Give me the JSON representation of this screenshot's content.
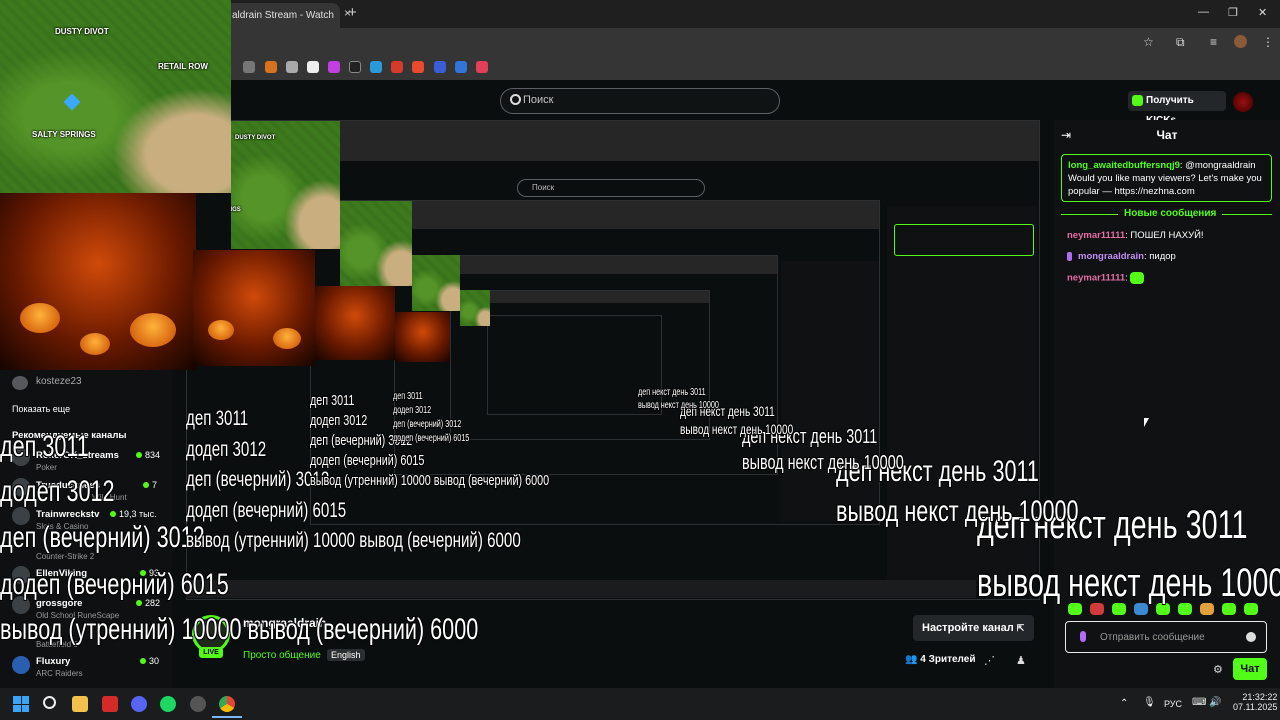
{
  "browser": {
    "tab_title": "aldrain Stream - Watch",
    "tab_close": "×",
    "new_tab": "+",
    "window_controls": [
      "—",
      "❐",
      "✕"
    ]
  },
  "header": {
    "search_placeholder": "Поиск",
    "get_kicks": "Получить KICKs"
  },
  "chat": {
    "title": "Чат",
    "pinned": {
      "user": "long_awaitedbuffersnqj9",
      "text": ": @mongraaldrain Would you like many viewers? Let's make you popular — https://nezhna.com"
    },
    "new_messages": "Новые сообщения",
    "messages": [
      {
        "user": "neymar11111",
        "text": ": ПОШЕЛ НАХУЙ!"
      },
      {
        "user": "mongraaldrain",
        "text": ": пидор"
      },
      {
        "user": "neymar11111",
        "text": ":"
      }
    ],
    "input_placeholder": "Отправить сообщение",
    "send_button": "Чат"
  },
  "stream": {
    "streamer": "mongraaldrain",
    "live": "LIVE",
    "category": "Просто общение",
    "language": "English",
    "setup_button": "Настройте канал",
    "viewers": "4 Зрителей"
  },
  "sidebar": {
    "user": "kosteze23",
    "show_more": "Показать еще",
    "recommended_header": "Рекомендуемые каналы",
    "channels": [
      {
        "name": "RokerOK_streams",
        "category": "Poker",
        "count": "834"
      },
      {
        "name": "Trueduckness",
        "category": "Wild Hunt",
        "count": "7"
      },
      {
        "name": "Trainwreckstv",
        "category": "Slots & Casino",
        "count": "19,3 тыс."
      },
      {
        "name": "",
        "category": "Counter-Strike 2",
        "count": ""
      },
      {
        "name": "EllenViking",
        "category": "",
        "count": "93"
      },
      {
        "name": "grossgore",
        "category": "Old School RuneScape",
        "count": "282"
      },
      {
        "name": "",
        "category": "Battlefield 6",
        "count": ""
      },
      {
        "name": "Fluxury",
        "category": "ARC Raiders",
        "count": "30"
      }
    ]
  },
  "map": {
    "labels": [
      "DUSTY DIVOT",
      "RETAIL ROW",
      "SALTY SPRINGS"
    ]
  },
  "overlay": {
    "line_dep": "деп некст день 3011",
    "line_out": "вывод некст день 10000",
    "left_lines": [
      "деп 3011",
      "додеп 3012",
      "деп (вечерний) 3012",
      "додеп (вечерний) 6015",
      "вывод (утренний) 10000 вывод (вечерний) 6000"
    ]
  },
  "taskbar": {
    "lang": "РУС",
    "time": "21:32:22",
    "date": "07.11.2025"
  },
  "colors": {
    "kick_green": "#53fc18",
    "page_bg": "#0b0e0f",
    "chat_bg": "#0f1112"
  }
}
